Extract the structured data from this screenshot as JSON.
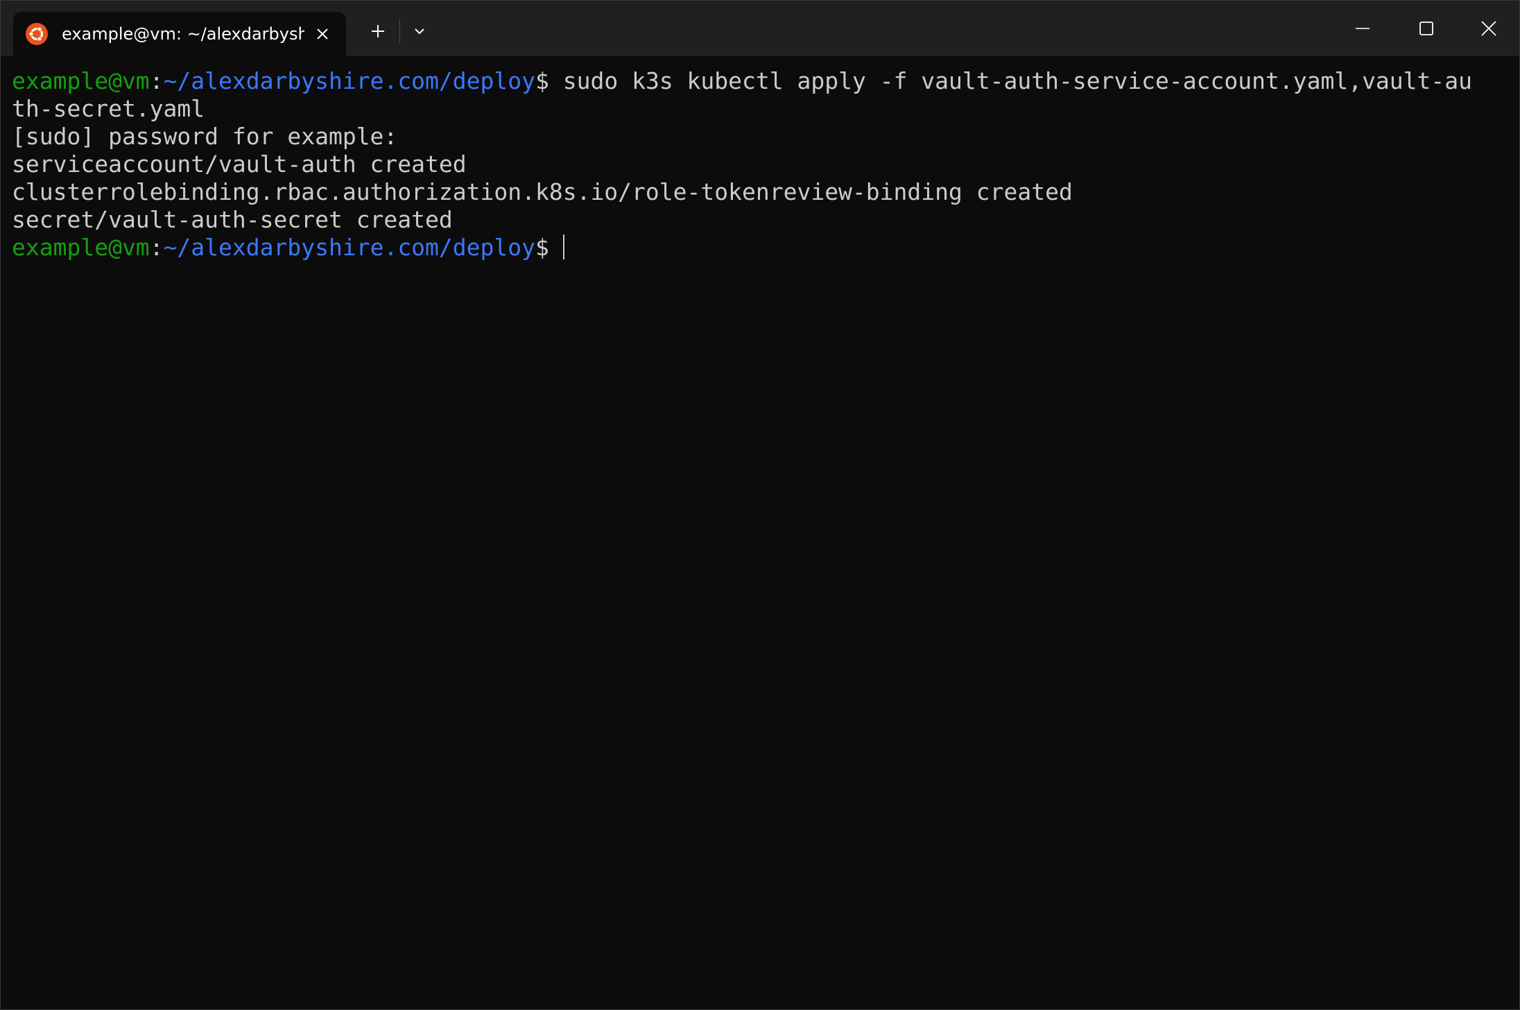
{
  "tab": {
    "title": "example@vm: ~/alexdarbyshire.com/deploy",
    "icon": "ubuntu-icon"
  },
  "titlebar": {
    "new_tab_icon": "plus-icon",
    "dropdown_icon": "chevron-down-icon",
    "close_tab_icon": "close-icon",
    "minimize_icon": "minimize-icon",
    "maximize_icon": "maximize-icon",
    "close_window_icon": "close-icon"
  },
  "colors": {
    "background": "#0c0c0c",
    "titlebar": "#202020",
    "user_host": "#13a10e",
    "path": "#3b78ff",
    "text": "#cccccc",
    "ubuntu": "#e95420"
  },
  "terminal": {
    "prompt_user": "example@vm",
    "prompt_colon": ":",
    "prompt_path": "~/alexdarbyshire.com/deploy",
    "prompt_symbol": "$",
    "command": " sudo k3s kubectl apply -f vault-auth-service-account.yaml,vault-au",
    "command_wrap": "th-secret.yaml",
    "output": [
      "[sudo] password for example:",
      "serviceaccount/vault-auth created",
      "clusterrolebinding.rbac.authorization.k8s.io/role-tokenreview-binding created",
      "secret/vault-auth-secret created"
    ]
  }
}
